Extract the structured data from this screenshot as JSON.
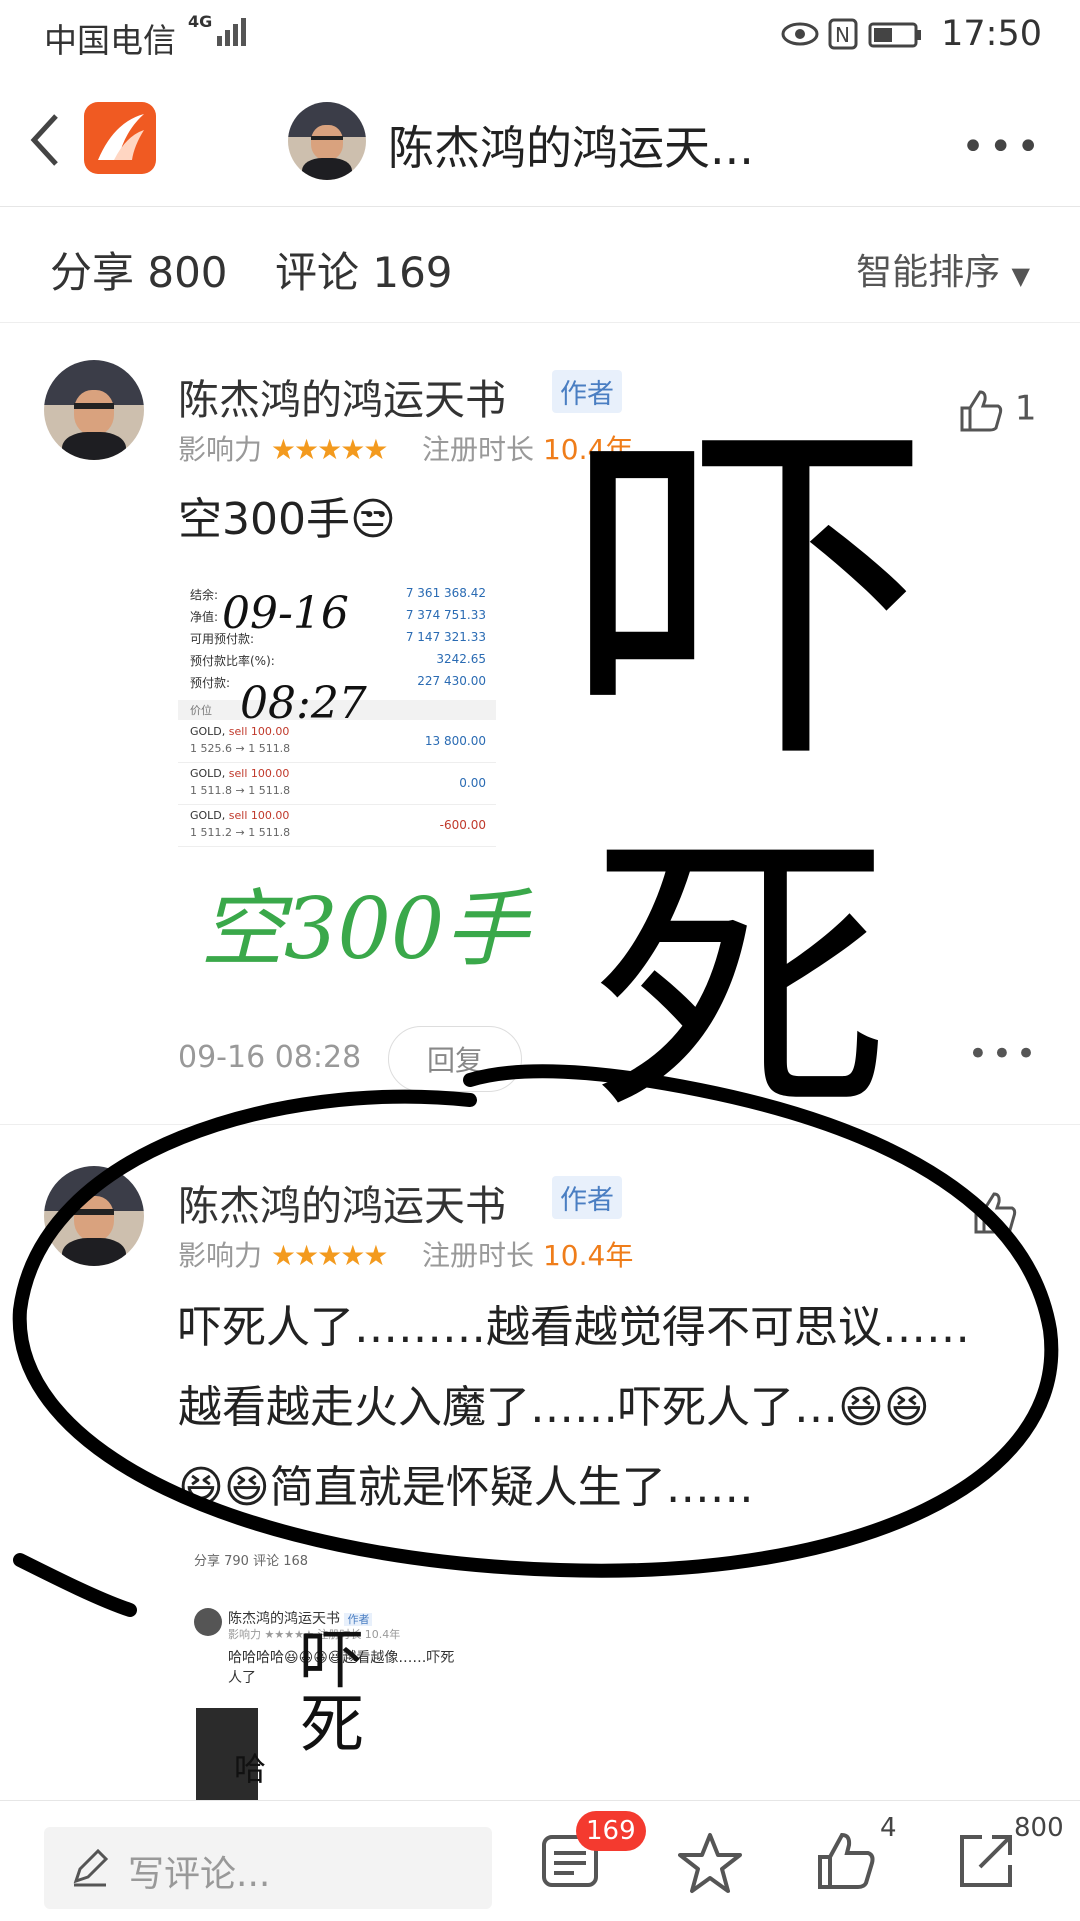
{
  "status_bar": {
    "carrier": "中国电信",
    "network": "4G",
    "time": "17:50"
  },
  "header": {
    "title": "陈杰鸿的鸿运天..."
  },
  "counts": {
    "share": "分享 800",
    "comments": "评论 169",
    "sort": "智能排序"
  },
  "comments": [
    {
      "author": "陈杰鸿的鸿运天书",
      "badge": "作者",
      "influence_label": "影响力",
      "stars": "★★★★★",
      "reg_label": "注册时长",
      "reg_years": "10.4年",
      "likes": "1",
      "text": "空300手",
      "emoji": "😒",
      "timestamp": "09-16 08:28",
      "reply_label": "回复",
      "screenshot": {
        "rows": [
          {
            "label": "结余:",
            "value": "7 361 368.42"
          },
          {
            "label": "净值:",
            "value": "7 374 751.33"
          },
          {
            "label": "可用预付款:",
            "value": "7 147 321.33"
          },
          {
            "label": "预付款比率(%):",
            "value": "3242.65"
          },
          {
            "label": "预付款:",
            "value": "227 430.00"
          }
        ],
        "section": "价位",
        "orders": [
          {
            "sym": "GOLD,",
            "side": "sell 100.00",
            "prices": "1 525.6 → 1 511.8",
            "pnl": "13 800.00",
            "pnl_color": "#2a6bb3"
          },
          {
            "sym": "GOLD,",
            "side": "sell 100.00",
            "prices": "1 511.8 → 1 511.8",
            "pnl": "0.00",
            "pnl_color": "#2a6bb3"
          },
          {
            "sym": "GOLD,",
            "side": "sell 100.00",
            "prices": "1 511.2 → 1 511.8",
            "pnl": "-600.00",
            "pnl_color": "#c0392b"
          }
        ],
        "handwriting_date": "09-16",
        "handwriting_time": "08:27",
        "handwriting_green": "空300手"
      }
    },
    {
      "author": "陈杰鸿的鸿运天书",
      "badge": "作者",
      "influence_label": "影响力",
      "stars": "★★★★★",
      "reg_label": "注册时长",
      "reg_years": "10.4年",
      "text_lines": [
        "吓死人了………越看越觉得不可思议……",
        "越看越走火入魔了……吓死人了…😆😆",
        "😆😆简直就是怀疑人生了……"
      ],
      "thumbnail": {
        "counts": "分享 790   评论 168",
        "author": "陈杰鸿的鸿运天书",
        "badge": "作者",
        "meta": "影响力 ★★★★★   注册时长 10.4年",
        "text": "哈哈哈哈😆😆😆😆越看越像……吓死人了"
      }
    }
  ],
  "overlay_handwriting": {
    "big1": "吓",
    "big2": "死",
    "thumb_hand": "吓死",
    "thumb_ha": "哈"
  },
  "bottom_bar": {
    "write_placeholder": "写评论...",
    "comment_badge": "169",
    "like_count": "4",
    "share_count": "800"
  },
  "colors": {
    "accent_orange": "#f05a22",
    "star": "#f39a1e",
    "badge_bg": "#e8f0fb",
    "red_badge": "#f43a2f",
    "green_ink": "#3aa84a"
  }
}
